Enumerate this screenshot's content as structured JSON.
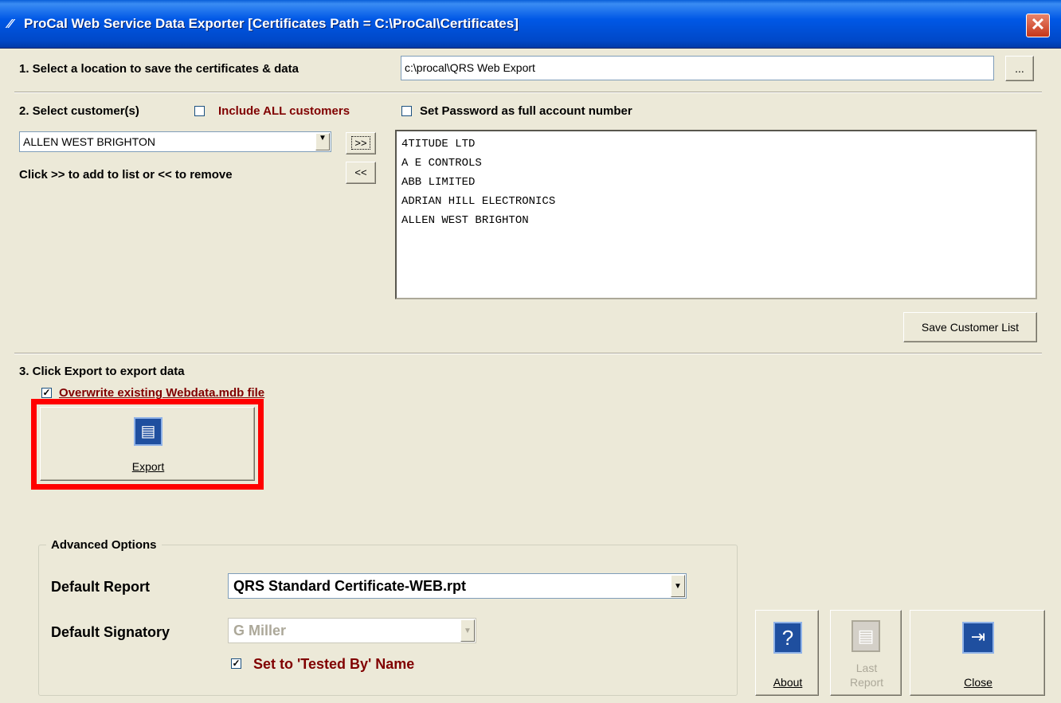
{
  "window": {
    "title": "ProCal Web Service Data Exporter [Certificates Path = C:\\ProCal\\Certificates]",
    "close_glyph": "✕"
  },
  "step1": {
    "label": "1. Select a location to save the certificates & data",
    "path_value": "c:\\procal\\QRS Web Export",
    "browse_label": "..."
  },
  "step2": {
    "label": "2. Select customer(s)",
    "include_all_label": "Include ALL customers",
    "include_all_checked": false,
    "set_password_label": "Set Password as full account number",
    "set_password_checked": false,
    "customer_select_value": "ALLEN WEST BRIGHTON",
    "add_button": ">>",
    "remove_button": "<<",
    "hint": "Click >> to add to list or << to remove",
    "selected_customers": [
      "4TITUDE LTD",
      "A E CONTROLS",
      "ABB LIMITED",
      "ADRIAN HILL ELECTRONICS",
      "ALLEN WEST BRIGHTON"
    ],
    "save_list_label": "Save Customer List"
  },
  "step3": {
    "label": "3. Click Export to export data",
    "overwrite_label": "Overwrite existing Webdata.mdb file",
    "overwrite_checked": true,
    "export_label": "Export"
  },
  "advanced": {
    "legend": "Advanced Options",
    "default_report_label": "Default Report",
    "default_report_value": "QRS Standard Certificate-WEB.rpt",
    "default_signatory_label": "Default Signatory",
    "default_signatory_value": "G Miller",
    "tested_by_label": "Set to 'Tested By' Name",
    "tested_by_checked": true
  },
  "footer": {
    "about_label": "About",
    "last_report_label_1": "Last",
    "last_report_label_2": "Report",
    "close_label": "Close"
  },
  "colors": {
    "titlebar": "#0058e6",
    "dialog_bg": "#ece9d8",
    "highlight_red": "#ff0000",
    "label_red": "#800000"
  }
}
